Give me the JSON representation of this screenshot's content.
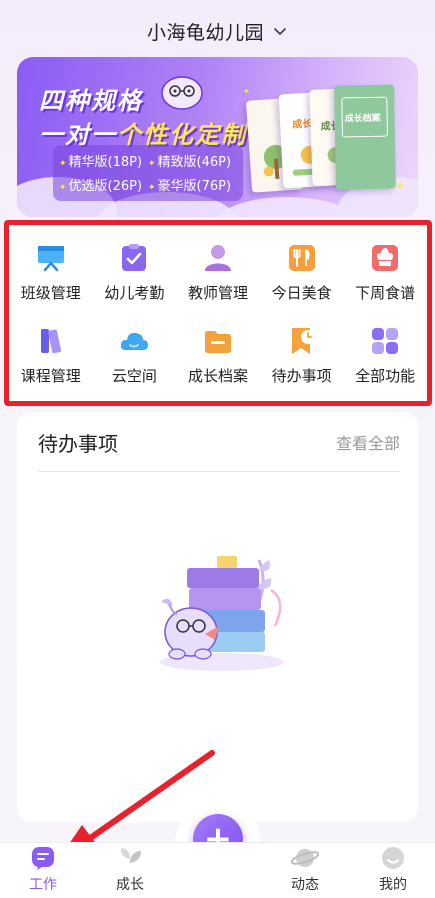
{
  "header": {
    "title": "小海龟幼儿园",
    "chevron_icon": "chevron-down-icon"
  },
  "banner": {
    "headline": "四种规格",
    "subline_prefix": "一对一",
    "subline_highlight": "个性化定制",
    "specs": [
      "精华版(18P)",
      "精致版(46P)",
      "优选版(26P)",
      "豪华版(76P)"
    ],
    "book_labels": [
      "成长",
      "成长",
      "成长档案"
    ]
  },
  "menu": {
    "items": [
      {
        "label": "班级管理",
        "icon": "class-board-icon"
      },
      {
        "label": "幼儿考勤",
        "icon": "attendance-clipboard-icon"
      },
      {
        "label": "教师管理",
        "icon": "teacher-person-icon"
      },
      {
        "label": "今日美食",
        "icon": "fork-knife-icon"
      },
      {
        "label": "下周食谱",
        "icon": "chef-hat-icon"
      },
      {
        "label": "课程管理",
        "icon": "course-books-icon"
      },
      {
        "label": "云空间",
        "icon": "cloud-icon"
      },
      {
        "label": "成长档案",
        "icon": "folder-icon"
      },
      {
        "label": "待办事项",
        "icon": "bookmark-clock-icon"
      },
      {
        "label": "全部功能",
        "icon": "four-squares-icon"
      }
    ]
  },
  "todo": {
    "title": "待办事项",
    "view_all": "查看全部"
  },
  "tabbar": {
    "tabs": [
      {
        "label": "工作",
        "icon": "work-list-icon",
        "active": true
      },
      {
        "label": "成长",
        "icon": "leaf-sprout-icon",
        "active": false
      },
      {
        "label": "动态",
        "icon": "planet-icon",
        "active": false
      },
      {
        "label": "我的",
        "icon": "smile-face-icon",
        "active": false
      }
    ],
    "fab_symbol": "+"
  },
  "colors": {
    "accent": "#8a5cf4",
    "highlight_frame": "#e8222c",
    "arrow": "#e8222c"
  }
}
